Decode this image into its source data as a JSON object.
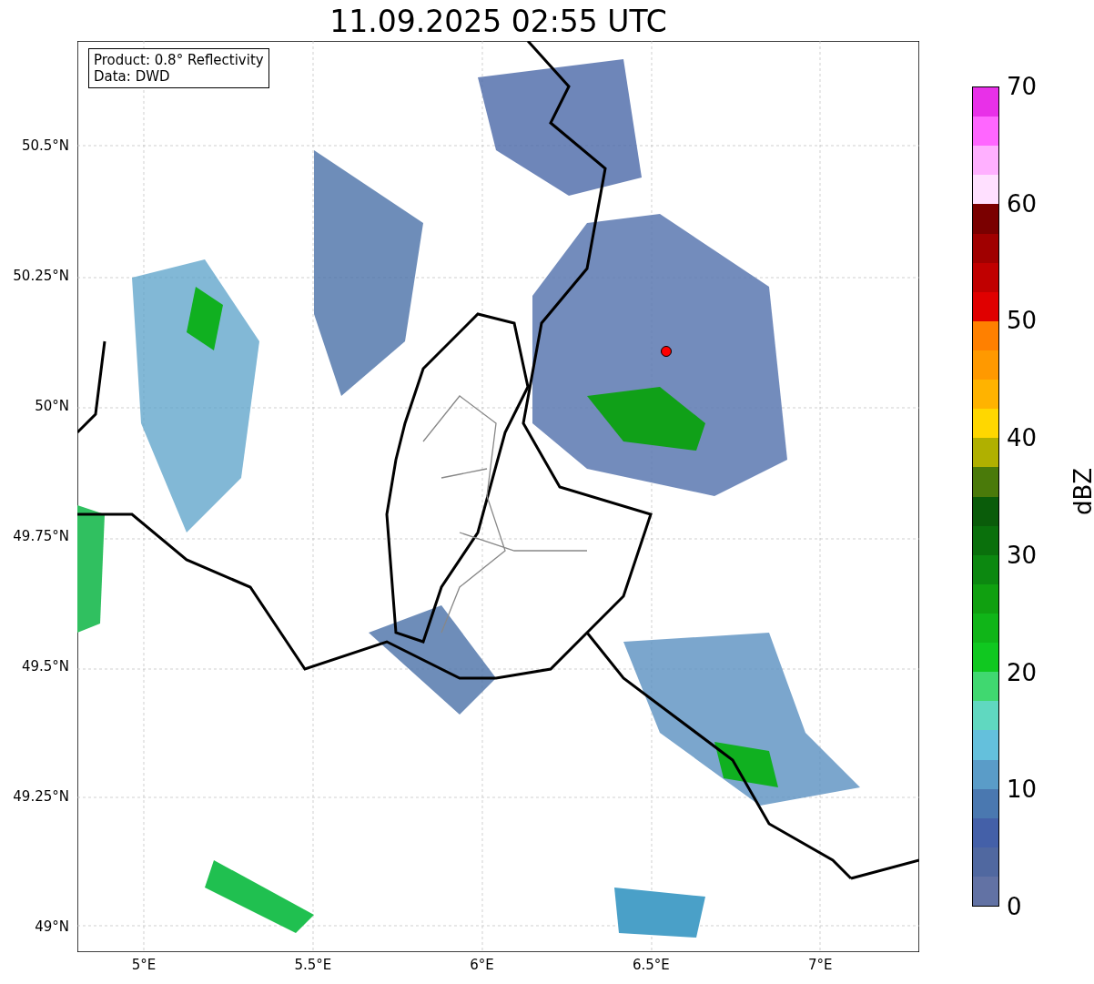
{
  "title": "11.09.2025 02:55 UTC",
  "info_box": [
    "Product: 0.8° Reflectivity",
    "Data: DWD"
  ],
  "lat_ticks": [
    "50.5°N",
    "50.25°N",
    "50°N",
    "49.75°N",
    "49.5°N",
    "49.25°N",
    "49°N"
  ],
  "lon_ticks": [
    "5°E",
    "5.5°E",
    "6°E",
    "6.5°E",
    "7°E"
  ],
  "colorbar": {
    "label": "dBZ",
    "ticks": [
      "70",
      "60",
      "50",
      "40",
      "30",
      "20",
      "10",
      "0"
    ],
    "bins": [
      {
        "color": "#e830e8"
      },
      {
        "color": "#ff66ff"
      },
      {
        "color": "#ffb0ff"
      },
      {
        "color": "#ffe0ff"
      },
      {
        "color": "#7a0000"
      },
      {
        "color": "#a00000"
      },
      {
        "color": "#c00000"
      },
      {
        "color": "#e00000"
      },
      {
        "color": "#ff8000"
      },
      {
        "color": "#ff9900"
      },
      {
        "color": "#ffb300"
      },
      {
        "color": "#ffd700"
      },
      {
        "color": "#b0b000"
      },
      {
        "color": "#4a7a0a"
      },
      {
        "color": "#0a5c0a"
      },
      {
        "color": "#0a700c"
      },
      {
        "color": "#0c8810"
      },
      {
        "color": "#10a010"
      },
      {
        "color": "#10b518"
      },
      {
        "color": "#10c820"
      },
      {
        "color": "#40d870"
      },
      {
        "color": "#60d8c0"
      },
      {
        "color": "#64c0dc"
      },
      {
        "color": "#5a9cc8"
      },
      {
        "color": "#4a78b0"
      },
      {
        "color": "#4460a8"
      },
      {
        "color": "#5068a0"
      },
      {
        "color": "#6272a4"
      }
    ]
  }
}
